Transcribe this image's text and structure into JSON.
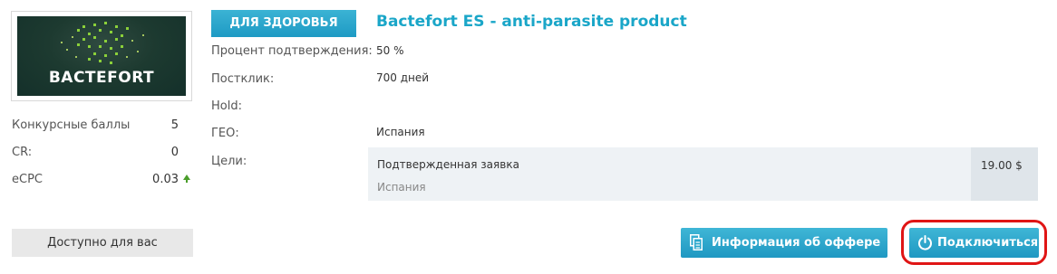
{
  "product": {
    "logo_text": "BACTEFORT",
    "category": "ДЛЯ ЗДОРОВЬЯ",
    "title": "Bactefort ES - anti-parasite product"
  },
  "stats": [
    {
      "label": "Конкурсные баллы",
      "value": "5"
    },
    {
      "label": "CR:",
      "value": "0"
    },
    {
      "label": "eCPC",
      "value": "0.03"
    }
  ],
  "ecpc_trend": "up",
  "availability_label": "Доступно для вас",
  "details": [
    {
      "label": "Процент подтверждения:",
      "value": "50 %"
    },
    {
      "label": "Постклик:",
      "value": "700 дней"
    },
    {
      "label": "Hold:",
      "value": ""
    },
    {
      "label": "ГЕО:",
      "value": "Испания"
    },
    {
      "label": "Цели:",
      "value": ""
    }
  ],
  "goals": [
    {
      "name": "Подтвержденная заявка",
      "geo": "Испания",
      "price": "19.00 $"
    }
  ],
  "buttons": {
    "info": "Информация об оффере",
    "connect": "Подключиться"
  },
  "colors": {
    "accent": "#1aa6c8",
    "button": "#2aa7cc",
    "highlight": "#e01515",
    "trend_up": "#4a9d2a"
  },
  "icons": {
    "info_button": "document-copy-icon",
    "connect_button": "power-icon",
    "trend": "arrow-up-icon"
  }
}
